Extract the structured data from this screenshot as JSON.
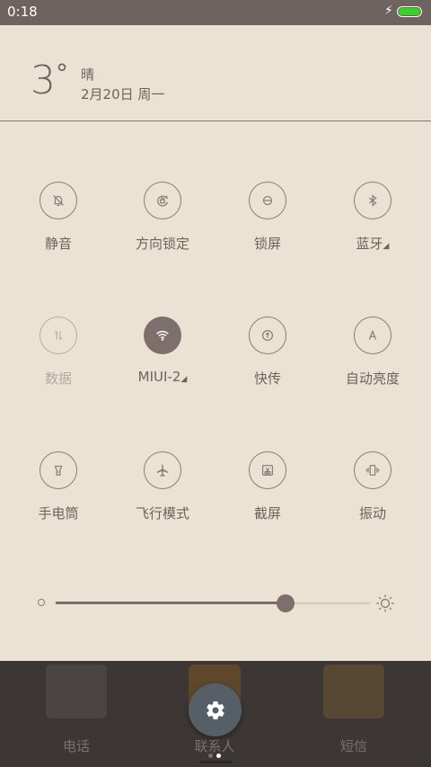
{
  "status_bar": {
    "time": "0:18",
    "battery_level": 1.0,
    "charging": true,
    "battery_color": "#3bcf2a"
  },
  "weather": {
    "temperature": "3",
    "degree_symbol": "°",
    "condition": "晴",
    "date": "2月20日 周一"
  },
  "quick_settings": {
    "row1": [
      {
        "label": "静音",
        "icon": "mute-bell-icon",
        "state": "normal"
      },
      {
        "label": "方向锁定",
        "icon": "rotation-lock-icon",
        "state": "normal"
      },
      {
        "label": "锁屏",
        "icon": "lock-screen-icon",
        "state": "normal"
      },
      {
        "label": "蓝牙",
        "icon": "bluetooth-icon",
        "state": "normal",
        "has_more": true
      }
    ],
    "row2": [
      {
        "label": "数据",
        "icon": "mobile-data-icon",
        "state": "disabled"
      },
      {
        "label": "MIUI-2",
        "icon": "wifi-icon",
        "state": "active",
        "has_more": true
      },
      {
        "label": "快传",
        "icon": "quick-transfer-icon",
        "state": "normal"
      },
      {
        "label": "自动亮度",
        "icon": "auto-brightness-icon",
        "state": "normal"
      }
    ],
    "row3": [
      {
        "label": "手电筒",
        "icon": "flashlight-icon",
        "state": "normal"
      },
      {
        "label": "飞行模式",
        "icon": "airplane-icon",
        "state": "normal"
      },
      {
        "label": "截屏",
        "icon": "screenshot-icon",
        "state": "normal"
      },
      {
        "label": "振动",
        "icon": "vibrate-icon",
        "state": "normal"
      }
    ]
  },
  "brightness": {
    "level": 0.73
  },
  "dock": {
    "apps": [
      {
        "label": "电话",
        "icon": "phone-app-icon"
      },
      {
        "label": "联系人",
        "icon": "contacts-app-icon"
      },
      {
        "label": "短信",
        "icon": "messages-app-icon"
      }
    ],
    "settings_icon": "gear-icon",
    "page_count": 2,
    "current_page": 2
  },
  "colors": {
    "background": "#ece2d3",
    "accent": "#7d706c",
    "status_bar": "#6f635f",
    "dock": "#3c3735"
  }
}
